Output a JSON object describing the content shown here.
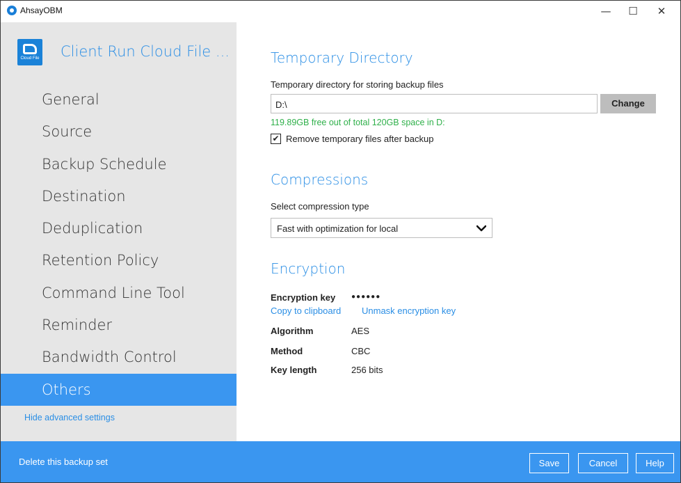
{
  "window": {
    "title": "AhsayOBM",
    "minimize": "—",
    "maximize": "☐",
    "close": "✕"
  },
  "sidebar": {
    "backup_set_title": "Client Run Cloud File ...",
    "backup_set_icon_caption": "Cloud File",
    "items": [
      {
        "label": "General"
      },
      {
        "label": "Source"
      },
      {
        "label": "Backup Schedule"
      },
      {
        "label": "Destination"
      },
      {
        "label": "Deduplication"
      },
      {
        "label": "Retention Policy"
      },
      {
        "label": "Command Line Tool"
      },
      {
        "label": "Reminder"
      },
      {
        "label": "Bandwidth Control"
      },
      {
        "label": "Others"
      }
    ],
    "active_item": "Others",
    "hide_advanced": "Hide advanced settings"
  },
  "temporary_directory": {
    "heading": "Temporary Directory",
    "label": "Temporary directory for storing backup files",
    "value": "D:\\",
    "change_button": "Change",
    "free_space": "119.89GB free out of total 120GB space in D:",
    "remove_checkbox_label": "Remove temporary files after backup",
    "remove_checked": true
  },
  "compressions": {
    "heading": "Compressions",
    "label": "Select compression type",
    "selected": "Fast with optimization for local"
  },
  "encryption": {
    "heading": "Encryption",
    "key_label": "Encryption key",
    "key_masked": "●●●●●●",
    "copy_link": "Copy to clipboard",
    "unmask_link": "Unmask encryption key",
    "algorithm_label": "Algorithm",
    "algorithm_value": "AES",
    "method_label": "Method",
    "method_value": "CBC",
    "key_length_label": "Key length",
    "key_length_value": "256 bits"
  },
  "footer": {
    "delete_set": "Delete this backup set",
    "save": "Save",
    "cancel": "Cancel",
    "help": "Help"
  },
  "colors": {
    "accent": "#3a96f0",
    "link": "#2a8ee5",
    "success": "#2fb04a",
    "sidebar_bg": "#e6e6e6"
  }
}
